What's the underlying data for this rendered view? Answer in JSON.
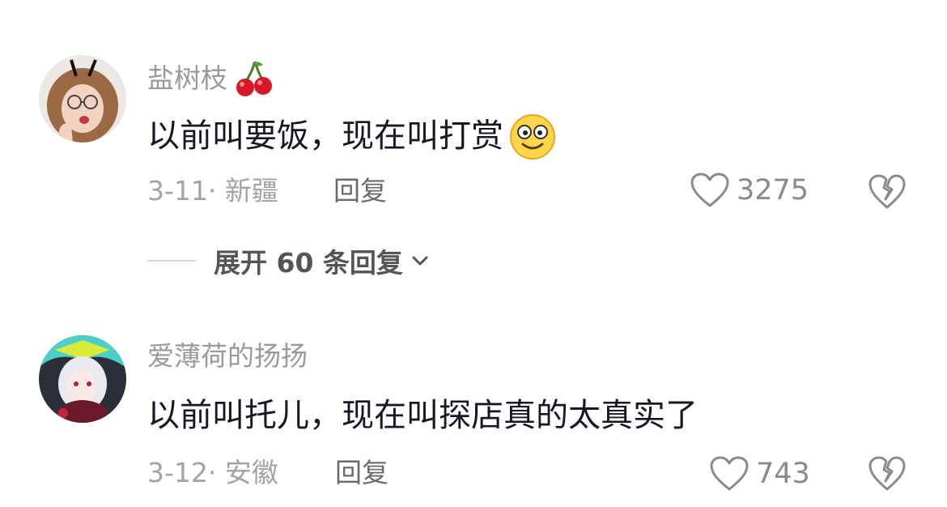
{
  "comments": [
    {
      "username": "盐树枝",
      "username_badge_icon": "cherry-icon",
      "text": "以前叫要饭，现在叫打赏",
      "emoji_icon": "smiling-face-emoji",
      "date": "3-11",
      "separator": "·",
      "location": "新疆",
      "reply_label": "回复",
      "like_count": "3275",
      "expand_label": "展开 60 条回复"
    },
    {
      "username": "爱薄荷的扬扬",
      "text": "以前叫托儿，现在叫探店真的太真实了",
      "date": "3-12",
      "separator": "·",
      "location": "安徽",
      "reply_label": "回复",
      "like_count": "743"
    }
  ],
  "colors": {
    "username": "#9a9a9a",
    "text": "#161823",
    "meta": "#a3a3a3",
    "icon": "#8a8a8a"
  }
}
